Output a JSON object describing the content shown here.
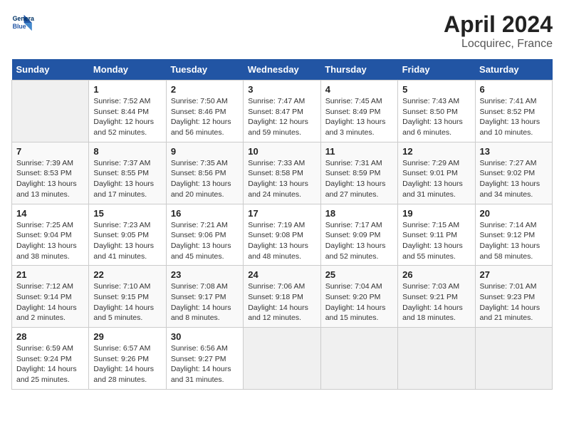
{
  "header": {
    "logo_line1": "General",
    "logo_line2": "Blue",
    "title": "April 2024",
    "subtitle": "Locquirec, France"
  },
  "days_of_week": [
    "Sunday",
    "Monday",
    "Tuesday",
    "Wednesday",
    "Thursday",
    "Friday",
    "Saturday"
  ],
  "weeks": [
    [
      {
        "day": "",
        "info": ""
      },
      {
        "day": "1",
        "info": "Sunrise: 7:52 AM\nSunset: 8:44 PM\nDaylight: 12 hours\nand 52 minutes."
      },
      {
        "day": "2",
        "info": "Sunrise: 7:50 AM\nSunset: 8:46 PM\nDaylight: 12 hours\nand 56 minutes."
      },
      {
        "day": "3",
        "info": "Sunrise: 7:47 AM\nSunset: 8:47 PM\nDaylight: 12 hours\nand 59 minutes."
      },
      {
        "day": "4",
        "info": "Sunrise: 7:45 AM\nSunset: 8:49 PM\nDaylight: 13 hours\nand 3 minutes."
      },
      {
        "day": "5",
        "info": "Sunrise: 7:43 AM\nSunset: 8:50 PM\nDaylight: 13 hours\nand 6 minutes."
      },
      {
        "day": "6",
        "info": "Sunrise: 7:41 AM\nSunset: 8:52 PM\nDaylight: 13 hours\nand 10 minutes."
      }
    ],
    [
      {
        "day": "7",
        "info": "Sunrise: 7:39 AM\nSunset: 8:53 PM\nDaylight: 13 hours\nand 13 minutes."
      },
      {
        "day": "8",
        "info": "Sunrise: 7:37 AM\nSunset: 8:55 PM\nDaylight: 13 hours\nand 17 minutes."
      },
      {
        "day": "9",
        "info": "Sunrise: 7:35 AM\nSunset: 8:56 PM\nDaylight: 13 hours\nand 20 minutes."
      },
      {
        "day": "10",
        "info": "Sunrise: 7:33 AM\nSunset: 8:58 PM\nDaylight: 13 hours\nand 24 minutes."
      },
      {
        "day": "11",
        "info": "Sunrise: 7:31 AM\nSunset: 8:59 PM\nDaylight: 13 hours\nand 27 minutes."
      },
      {
        "day": "12",
        "info": "Sunrise: 7:29 AM\nSunset: 9:01 PM\nDaylight: 13 hours\nand 31 minutes."
      },
      {
        "day": "13",
        "info": "Sunrise: 7:27 AM\nSunset: 9:02 PM\nDaylight: 13 hours\nand 34 minutes."
      }
    ],
    [
      {
        "day": "14",
        "info": "Sunrise: 7:25 AM\nSunset: 9:04 PM\nDaylight: 13 hours\nand 38 minutes."
      },
      {
        "day": "15",
        "info": "Sunrise: 7:23 AM\nSunset: 9:05 PM\nDaylight: 13 hours\nand 41 minutes."
      },
      {
        "day": "16",
        "info": "Sunrise: 7:21 AM\nSunset: 9:06 PM\nDaylight: 13 hours\nand 45 minutes."
      },
      {
        "day": "17",
        "info": "Sunrise: 7:19 AM\nSunset: 9:08 PM\nDaylight: 13 hours\nand 48 minutes."
      },
      {
        "day": "18",
        "info": "Sunrise: 7:17 AM\nSunset: 9:09 PM\nDaylight: 13 hours\nand 52 minutes."
      },
      {
        "day": "19",
        "info": "Sunrise: 7:15 AM\nSunset: 9:11 PM\nDaylight: 13 hours\nand 55 minutes."
      },
      {
        "day": "20",
        "info": "Sunrise: 7:14 AM\nSunset: 9:12 PM\nDaylight: 13 hours\nand 58 minutes."
      }
    ],
    [
      {
        "day": "21",
        "info": "Sunrise: 7:12 AM\nSunset: 9:14 PM\nDaylight: 14 hours\nand 2 minutes."
      },
      {
        "day": "22",
        "info": "Sunrise: 7:10 AM\nSunset: 9:15 PM\nDaylight: 14 hours\nand 5 minutes."
      },
      {
        "day": "23",
        "info": "Sunrise: 7:08 AM\nSunset: 9:17 PM\nDaylight: 14 hours\nand 8 minutes."
      },
      {
        "day": "24",
        "info": "Sunrise: 7:06 AM\nSunset: 9:18 PM\nDaylight: 14 hours\nand 12 minutes."
      },
      {
        "day": "25",
        "info": "Sunrise: 7:04 AM\nSunset: 9:20 PM\nDaylight: 14 hours\nand 15 minutes."
      },
      {
        "day": "26",
        "info": "Sunrise: 7:03 AM\nSunset: 9:21 PM\nDaylight: 14 hours\nand 18 minutes."
      },
      {
        "day": "27",
        "info": "Sunrise: 7:01 AM\nSunset: 9:23 PM\nDaylight: 14 hours\nand 21 minutes."
      }
    ],
    [
      {
        "day": "28",
        "info": "Sunrise: 6:59 AM\nSunset: 9:24 PM\nDaylight: 14 hours\nand 25 minutes."
      },
      {
        "day": "29",
        "info": "Sunrise: 6:57 AM\nSunset: 9:26 PM\nDaylight: 14 hours\nand 28 minutes."
      },
      {
        "day": "30",
        "info": "Sunrise: 6:56 AM\nSunset: 9:27 PM\nDaylight: 14 hours\nand 31 minutes."
      },
      {
        "day": "",
        "info": ""
      },
      {
        "day": "",
        "info": ""
      },
      {
        "day": "",
        "info": ""
      },
      {
        "day": "",
        "info": ""
      }
    ]
  ]
}
